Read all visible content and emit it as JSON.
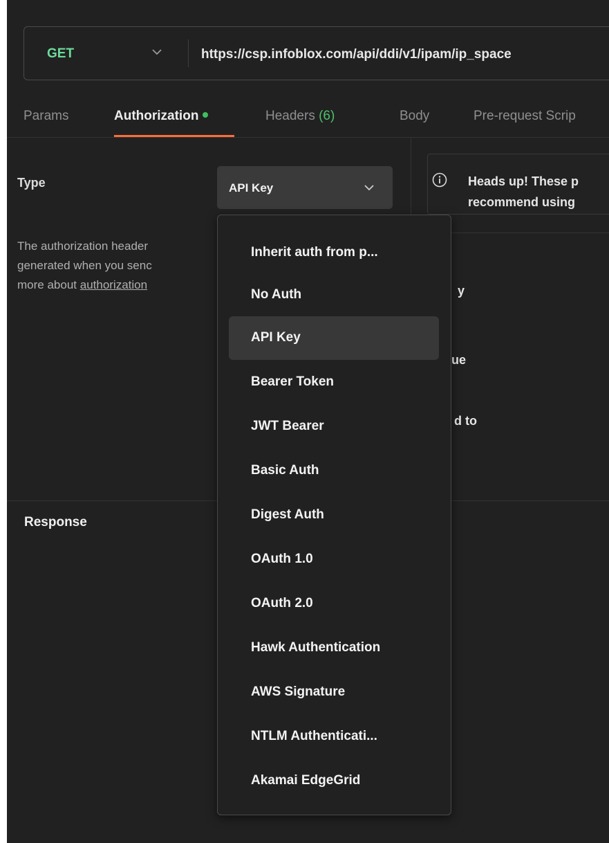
{
  "request": {
    "method": "GET",
    "url": "https://csp.infoblox.com/api/ddi/v1/ipam/ip_space"
  },
  "tabs": {
    "params": "Params",
    "authorization": "Authorization",
    "headers": "Headers",
    "headers_count": "(6)",
    "body": "Body",
    "prerequest": "Pre-request Scrip"
  },
  "auth": {
    "type_label": "Type",
    "selected_type": "API Key",
    "description_lines": [
      "The authorization header",
      "generated when you senc",
      "more about "
    ],
    "description_link": "authorization"
  },
  "notice": {
    "line1": "Heads up! These p",
    "line2": "recommend using"
  },
  "right_fragments": {
    "key": "y",
    "value": "ue",
    "add_to": "d to"
  },
  "response": {
    "label": "Response"
  },
  "menu": {
    "items": [
      "Inherit auth from p...",
      "No Auth",
      "API Key",
      "Bearer Token",
      "JWT Bearer",
      "Basic Auth",
      "Digest Auth",
      "OAuth 1.0",
      "OAuth 2.0",
      "Hawk Authentication",
      "AWS Signature",
      "NTLM Authenticati...",
      "Akamai EdgeGrid"
    ]
  },
  "colors": {
    "background": "#212121",
    "method": "#6bdd9a",
    "accent": "#ff6c37",
    "status_dot": "#3fbf5f"
  },
  "icons": {
    "method_dropdown": "chevron-down-icon",
    "type_dropdown": "chevron-down-icon",
    "notice": "info-icon"
  }
}
